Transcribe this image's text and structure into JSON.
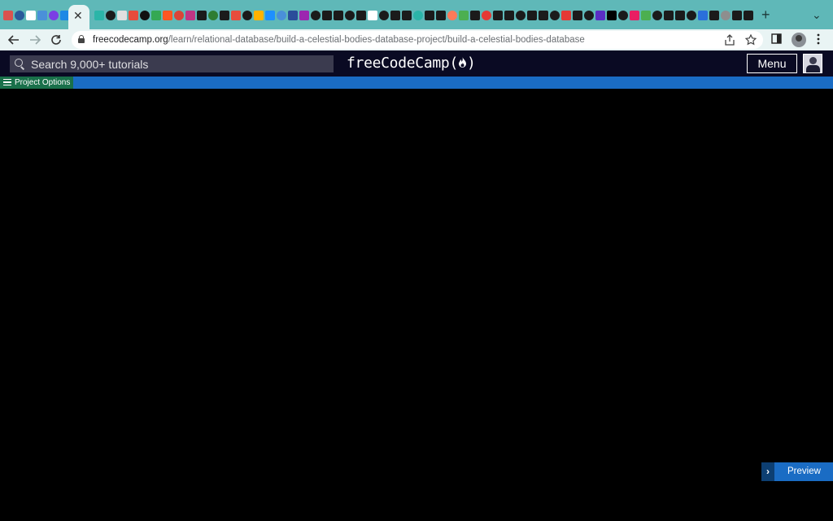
{
  "browser": {
    "new_tab_glyph": "+",
    "tab_menu_glyph": "⌄",
    "active_tab_close_glyph": "✕",
    "favicon_colors": [
      "#d9534f",
      "#2a5a9a",
      "#ffffff",
      "#4a90d9",
      "#7b3fe4",
      "#1e88e5",
      "#2bb5a8",
      "#1b1b1b",
      "#e0e0e0",
      "#e74c3c",
      "#111111",
      "#34a853",
      "#ff5722",
      "#db4437",
      "#c13584",
      "#1b1b1b",
      "#2e7d32",
      "#1b1b1b",
      "#e74c3c",
      "#1b1b1b",
      "#ffb300",
      "#1e90ff",
      "#4a90d9",
      "#2a4d9a",
      "#9c27b0",
      "#1b1b1b",
      "#1b1b1b",
      "#1b1b1b",
      "#1b1b1b",
      "#1b1b1b",
      "#ffffff",
      "#1b1b1b",
      "#1b1b1b",
      "#1b1b1b",
      "#2bb5a8",
      "#1b1b1b",
      "#1b1b1b",
      "#ff7a59",
      "#4caf50",
      "#1b1b1b",
      "#e53935",
      "#1b1b1b",
      "#1b1b1b",
      "#1b1b1b",
      "#1b1b1b",
      "#1b1b1b",
      "#1b1b1b",
      "#e53935",
      "#1b1b1b",
      "#1b1b1b",
      "#5a2dc4",
      "#000000",
      "#1b1b1b",
      "#e91e63",
      "#4caf50",
      "#1b1b1b",
      "#1b1b1b",
      "#1b1b1b",
      "#1b1b1b",
      "#2a6fdb",
      "#1b1b1b",
      "#8e8e8e",
      "#1b1b1b",
      "#1b1b1b",
      "#2196f3",
      "#3f51b5",
      "#7c4dff",
      "#5a5a5a",
      "#333333",
      "#333333",
      "#6d4c41",
      "#5d4037"
    ],
    "url_host": "freecodecamp.org",
    "url_path": "/learn/relational-database/build-a-celestial-bodies-database-project/build-a-celestial-bodies-database",
    "icons": {
      "back": "back-arrow-icon",
      "forward": "forward-arrow-icon",
      "reload": "reload-icon",
      "share": "share-icon",
      "bookmark": "star-icon",
      "sidebar": "sidebar-icon",
      "more": "more-vert-icon"
    }
  },
  "fcc_nav": {
    "search_placeholder": "Search 9,000+ tutorials",
    "logo_text": "freeCodeCamp",
    "logo_open": "(",
    "logo_flame": "🔥",
    "logo_close": ")",
    "menu_label": "Menu"
  },
  "options_bar": {
    "label": "Project Options"
  },
  "workspace": {
    "preview_label": "Preview",
    "preview_chevron": "›"
  },
  "colors": {
    "tabstrip": "#5fb8b8",
    "toolbar": "#e9f4f4",
    "fcc_nav": "#0a0a23",
    "options_bar": "#1a6cc4",
    "options_button": "#19704a",
    "workspace": "#000000",
    "preview_button": "#1a6cc4"
  }
}
